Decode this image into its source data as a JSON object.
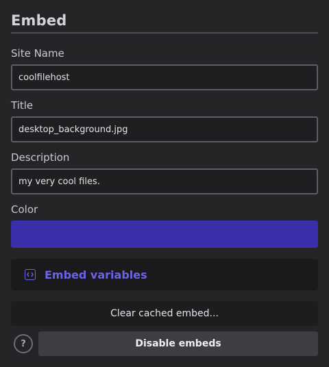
{
  "section": {
    "title": "Embed"
  },
  "fields": {
    "site_name": {
      "label": "Site Name",
      "value": "coolfilehost"
    },
    "title": {
      "label": "Title",
      "value": "desktop_background.jpg"
    },
    "description": {
      "label": "Description",
      "value": "my very cool files."
    },
    "color": {
      "label": "Color",
      "value": "#3a2fa8"
    }
  },
  "variables_button": {
    "label": "Embed variables",
    "icon": "code-icon"
  },
  "actions": {
    "clear_label": "Clear cached embed...",
    "help_label": "?",
    "disable_label": "Disable embeds"
  },
  "colors": {
    "accent": "#6c63e6",
    "swatch": "#3a2fa8"
  }
}
